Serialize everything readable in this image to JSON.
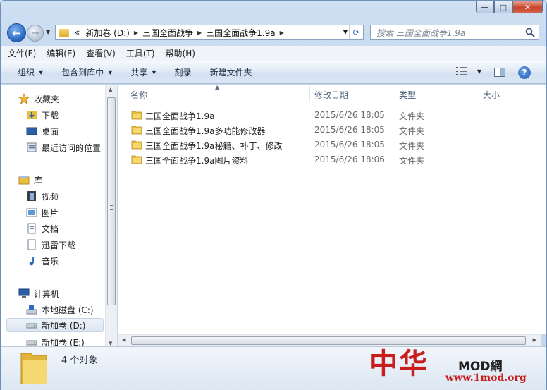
{
  "window": {
    "controls": {
      "minimize": "—",
      "maximize": "□",
      "close": "✕"
    }
  },
  "address": {
    "overflow": "«",
    "segments": [
      "新加卷 (D:)",
      "三国全面战争",
      "三国全面战争1.9a"
    ]
  },
  "search": {
    "placeholder": "搜索 三国全面战争1.9a"
  },
  "menu": [
    "文件(F)",
    "编辑(E)",
    "查看(V)",
    "工具(T)",
    "帮助(H)"
  ],
  "commands": {
    "organize": "组织",
    "include_library": "包含到库中",
    "share": "共享",
    "burn": "刻录",
    "new_folder": "新建文件夹"
  },
  "nav": {
    "favorites": {
      "title": "收藏夹",
      "items": [
        "下载",
        "桌面",
        "最近访问的位置"
      ]
    },
    "libraries": {
      "title": "库",
      "items": [
        "视频",
        "图片",
        "文档",
        "迅雷下载",
        "音乐"
      ]
    },
    "computer": {
      "title": "计算机",
      "items": [
        "本地磁盘 (C:)",
        "新加卷 (D:)",
        "新加卷 (E:)"
      ]
    },
    "selected": "新加卷 (D:)"
  },
  "columns": {
    "name": "名称",
    "modified": "修改日期",
    "type": "类型",
    "size": "大小"
  },
  "files": [
    {
      "name": "三国全面战争1.9a",
      "modified": "2015/6/26 18:05",
      "type": "文件夹"
    },
    {
      "name": "三国全面战争1.9a多功能修改器",
      "modified": "2015/6/26 18:05",
      "type": "文件夹"
    },
    {
      "name": "三国全面战争1.9a秘籍、补丁、修改",
      "modified": "2015/6/26 18:05",
      "type": "文件夹"
    },
    {
      "name": "三国全面战争1.9a图片资料",
      "modified": "2015/6/26 18:06",
      "type": "文件夹"
    }
  ],
  "status": {
    "count": "4 个对象"
  },
  "watermark": {
    "brand": "中华",
    "mod": "MOD網",
    "url": "www.1mod.org"
  },
  "colors": {
    "accent": "#1d58ae",
    "folder": "#e8bf3f",
    "watermark": "#c81e1e"
  }
}
